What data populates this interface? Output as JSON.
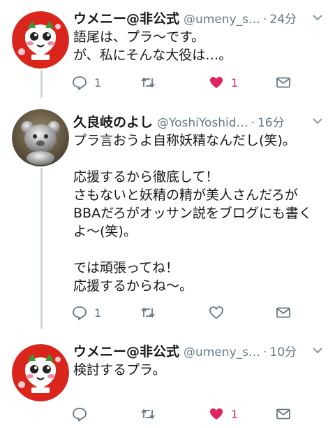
{
  "tweets": [
    {
      "name": "ウメニー@非公式",
      "handle": "@umeny_s…",
      "time": "24分",
      "text": "語尾は、プラ〜です。\nが、私にそんな大役は…。",
      "reply_count": "1",
      "retweet_count": "",
      "like_count": "1",
      "liked": true
    },
    {
      "name": "久良岐のよし",
      "handle": "@YoshiYoshid…",
      "time": "16分",
      "text": "プラ言おうよ自称妖精なんだし(笑)。\n\n応援するから徹底して！\nさもないと妖精の精が美人さんだろが\nBBAだろがオッサン説をブログにも書く\nよ〜(笑)。\n\nでは頑張ってね！\n応援するからね〜。",
      "reply_count": "1",
      "retweet_count": "",
      "like_count": "",
      "liked": false
    },
    {
      "name": "ウメニー@非公式",
      "handle": "@umeny_s…",
      "time": "10分",
      "text": "検討するプラ。",
      "reply_count": "",
      "retweet_count": "",
      "like_count": "1",
      "liked": true
    }
  ],
  "colors": {
    "like": "#e0245e",
    "muted": "#657786",
    "thread_line": "#ccd6dd",
    "mascot_bg": "#d9251c"
  },
  "icons": {
    "reply": "speech-bubble-icon",
    "retweet": "retweet-arrows-icon",
    "like": "heart-icon",
    "dm": "envelope-icon",
    "menu": "chevron-down-icon"
  }
}
